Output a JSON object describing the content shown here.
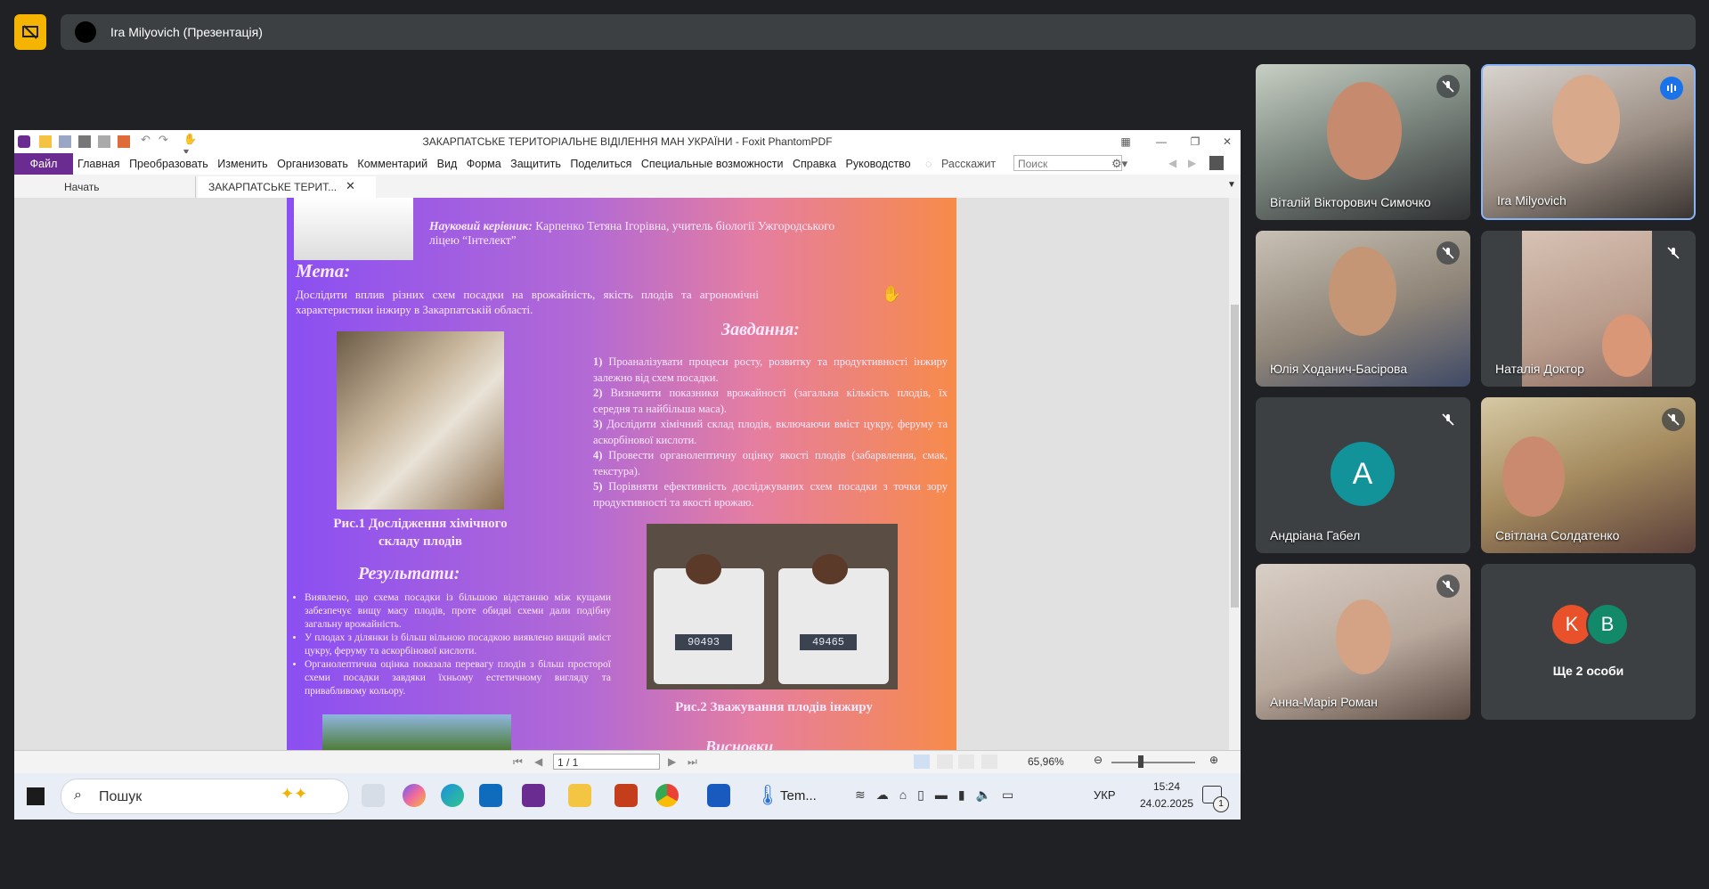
{
  "meeting": {
    "presenter_title": "Ira Milyovich (Презентація)"
  },
  "app": {
    "window_title": "ЗАКАРПАТСЬКЕ ТЕРИТОРІАЛЬНЕ ВІДІЛЕННЯ МАН УКРАЇНИ - Foxit PhantomPDF",
    "menu_file": "Файл",
    "menu": [
      "Главная",
      "Преобразовать",
      "Изменить",
      "Организовать",
      "Комментарий",
      "Вид",
      "Форма",
      "Защитить",
      "Поделиться",
      "Специальные возможности",
      "Справка",
      "Руководство"
    ],
    "tell_me": "Расскажит",
    "search_placeholder": "Поиск",
    "tabs": [
      "Начать",
      "ЗАКАРПАТСЬКЕ ТЕРИТ..."
    ],
    "page_indicator": "1 / 1",
    "zoom": "65,96%"
  },
  "poster": {
    "supervisor_label": "Науковий керівник:",
    "supervisor_text": "Карпенко Тетяна Ігорівна,   учитель біології  Ужгородського",
    "supervisor_text2": "ліцею “Інтелект”",
    "goal_heading": "Мета:",
    "goal_text": "Дослідити вплив різних схем посадки на врожайність, якість плодів та агрономічні характеристики інжиру в Закарпатській області.",
    "tasks_heading": "Завдання:",
    "tasks": [
      {
        "num": "1)",
        "text": "Проаналізувати процеси росту, розвитку та продуктивності інжиру залежно від схем посадки."
      },
      {
        "num": "2)",
        "text": "Визначити показники врожайності (загальна кількість плодів, їх середня та найбільша маса)."
      },
      {
        "num": "3)",
        "text": "Дослідити хімічний склад плодів, включаючи вміст цукру, феруму та аскорбінової кислоти."
      },
      {
        "num": "4)",
        "text": "Провести органолептичну оцінку якості плодів (забарвлення, смак, текстура)."
      },
      {
        "num": "5)",
        "text": "Порівняти ефективність досліджуваних схем посадки з точки зору продуктивності та якості врожаю."
      }
    ],
    "fig1_caption": "Рис.1 Дослідження хімічного складу плодів",
    "results_heading": "Результати:",
    "results": [
      "Виявлено, що схема посадки із більшою відстанню між кущами забезпечує вищу масу плодів, проте обидві схеми дали подібну загальну врожайність.",
      "У плодах з ділянки із більш вільною посадкою виявлено вищий вміст цукру, феруму та аскорбінової кислоти.",
      "Органолептична оцінка показала перевагу плодів з більш просторої схеми посадки завдяки їхньому естетичному вигляду та привабливому кольору."
    ],
    "scale1": "90493",
    "scale2": "49465",
    "fig2_caption": "Рис.2 Зважування плодів інжиру",
    "conclusions_heading": "Висновки"
  },
  "taskbar": {
    "search": "Пошук",
    "temp": "Tem...",
    "lang": "УКР",
    "time": "15:24",
    "date": "24.02.2025",
    "notif_count": "1"
  },
  "participants": [
    {
      "name": "Віталій Вікторович Симочко",
      "muted": true
    },
    {
      "name": "Ira Milyovich",
      "muted": false,
      "speaking": true
    },
    {
      "name": "Юлія Ходанич-Басірова",
      "muted": true
    },
    {
      "name": "Наталія Доктор",
      "muted": true
    },
    {
      "name": "Андріана Габел",
      "muted": true,
      "initial": "A",
      "avatar_color": "#12939a"
    },
    {
      "name": "Світлана Солдатенко",
      "muted": true
    },
    {
      "name": "Анна-Марія Роман",
      "muted": true
    },
    {
      "name": "Ще 2 особи",
      "initials": [
        "K",
        "B"
      ],
      "avatar_colors": [
        "#e8512a",
        "#128a6a"
      ]
    }
  ]
}
